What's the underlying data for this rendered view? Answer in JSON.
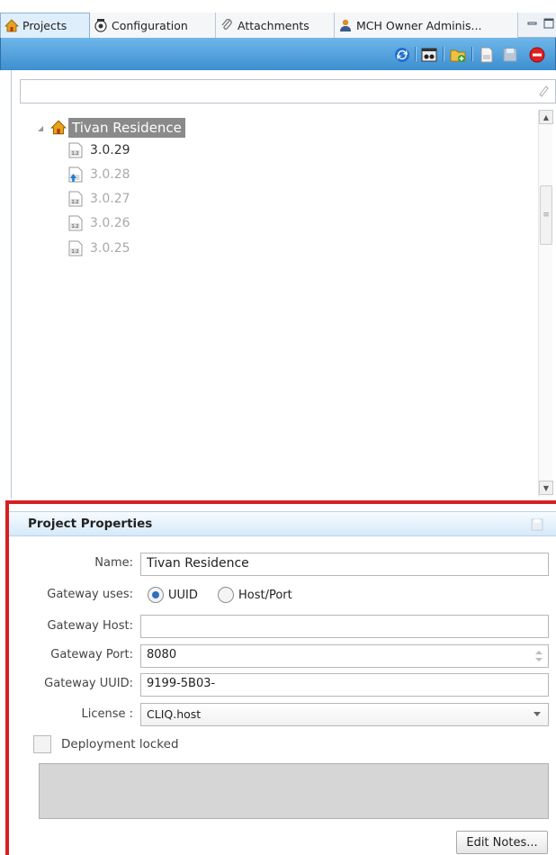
{
  "tabs": [
    {
      "label": "Projects",
      "icon": "home-icon",
      "active": true
    },
    {
      "label": "Configuration",
      "icon": "config-icon",
      "active": false
    },
    {
      "label": "Attachments",
      "icon": "paperclip-icon",
      "active": false
    },
    {
      "label": "MCH Owner Adminis...",
      "icon": "user-icon",
      "active": false
    }
  ],
  "toolbar": {
    "icons": [
      "refresh-icon",
      "view-icon",
      "add-project-icon",
      "version-icon",
      "save-icon",
      "delete-icon"
    ]
  },
  "filter": {
    "value": "",
    "placeholder": ""
  },
  "tree": {
    "root": {
      "label": "Tivan Residence",
      "icon": "home-icon"
    },
    "versions": [
      {
        "label": "3.0.29",
        "icon": "version-file-icon",
        "active": true
      },
      {
        "label": "3.0.28",
        "icon": "version-upload-icon",
        "active": false
      },
      {
        "label": "3.0.27",
        "icon": "version-file-icon",
        "active": false
      },
      {
        "label": "3.0.26",
        "icon": "version-file-icon",
        "active": false
      },
      {
        "label": "3.0.25",
        "icon": "version-file-icon",
        "active": false
      }
    ]
  },
  "properties": {
    "title": "Project Properties",
    "name_label": "Name:",
    "name_value": "Tivan Residence",
    "gateway_uses_label": "Gateway uses:",
    "gateway_uses_options": [
      "UUID",
      "Host/Port"
    ],
    "gateway_uses_selected": "UUID",
    "gateway_host_label": "Gateway Host:",
    "gateway_host_value": "",
    "gateway_port_label": "Gateway Port:",
    "gateway_port_value": "8080",
    "gateway_uuid_label": "Gateway UUID:",
    "gateway_uuid_value": "9199-5B03-",
    "license_label": "License :",
    "license_value": "CLIQ.host",
    "deployment_locked_label": "Deployment locked",
    "deployment_locked": false,
    "notes_value": "",
    "edit_notes_label": "Edit Notes..."
  },
  "colors": {
    "toolbar": "#4a9be0",
    "highlight_border": "#d62020",
    "tree_selection": "#8a8a8a",
    "radio_selected": "#2f6fbf"
  }
}
